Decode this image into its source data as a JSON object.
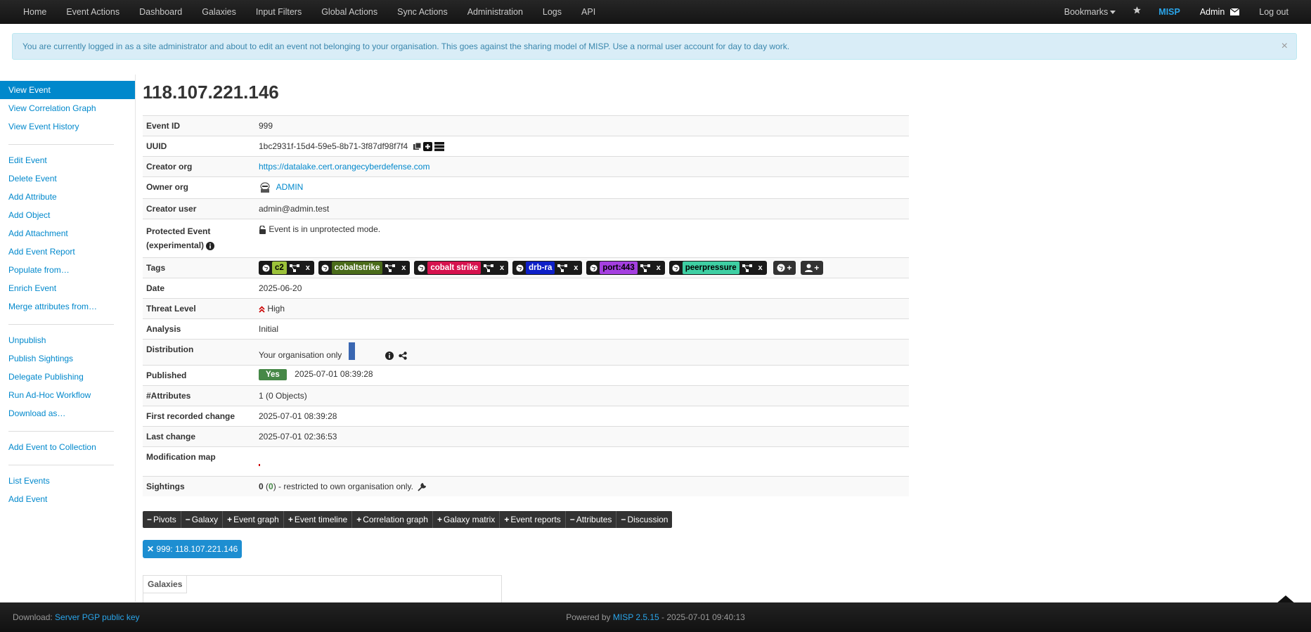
{
  "nav": {
    "left": [
      "Home",
      "Event Actions",
      "Dashboard",
      "Galaxies",
      "Input Filters",
      "Global Actions",
      "Sync Actions",
      "Administration",
      "Logs",
      "API"
    ],
    "bookmarks": "Bookmarks",
    "misp": "MISP",
    "admin": "Admin",
    "logout": "Log out"
  },
  "alert": {
    "text": "You are currently logged in as a site administrator and about to edit an event not belonging to your organisation. This goes against the sharing model of MISP. Use a normal user account for day to day work.",
    "close": "×"
  },
  "sidebar": {
    "group1": [
      "View Event",
      "View Correlation Graph",
      "View Event History"
    ],
    "group2": [
      "Edit Event",
      "Delete Event",
      "Add Attribute",
      "Add Object",
      "Add Attachment",
      "Add Event Report",
      "Populate from…",
      "Enrich Event",
      "Merge attributes from…"
    ],
    "group3": [
      "Unpublish",
      "Publish Sightings",
      "Delegate Publishing",
      "Run Ad-Hoc Workflow",
      "Download as…"
    ],
    "group4": [
      "Add Event to Collection"
    ],
    "group5": [
      "List Events",
      "Add Event"
    ]
  },
  "event": {
    "title": "118.107.221.146",
    "labels": {
      "id": "Event ID",
      "uuid": "UUID",
      "creator_org": "Creator org",
      "owner_org": "Owner org",
      "creator_user": "Creator user",
      "protected": "Protected Event (experimental)",
      "tags": "Tags",
      "date": "Date",
      "threat": "Threat Level",
      "analysis": "Analysis",
      "distribution": "Distribution",
      "published": "Published",
      "attributes": "#Attributes",
      "first_change": "First recorded change",
      "last_change": "Last change",
      "modmap": "Modification map",
      "sightings": "Sightings"
    },
    "id": "999",
    "uuid": "1bc2931f-15d4-59e5-8b71-3f87df98f7f4",
    "creator_org": "https://datalake.cert.orangecyberdefense.com",
    "owner_org": "ADMIN",
    "creator_user": "admin@admin.test",
    "protected": "Event is in unprotected mode.",
    "date": "2025-06-20",
    "threat": "High",
    "analysis": "Initial",
    "distribution": "Your organisation only",
    "published_badge": "Yes",
    "published_date": "2025-07-01 08:39:28",
    "attributes": "1 (0 Objects)",
    "first_change": "2025-07-01 08:39:28",
    "last_change": "2025-07-01 02:36:53",
    "sightings_count": "0",
    "sightings_paren_open": " (",
    "sightings_inner": "0",
    "sightings_rest": ") - restricted to own organisation only."
  },
  "tags": [
    {
      "name": "c2",
      "bg": "#9cc23a",
      "fg": "#000"
    },
    {
      "name": "cobaltstrike",
      "bg": "#4a6b1a",
      "fg": "#fff"
    },
    {
      "name": "cobalt strike",
      "bg": "#d6124e",
      "fg": "#fff"
    },
    {
      "name": "drb-ra",
      "bg": "#0d1fc7",
      "fg": "#fff"
    },
    {
      "name": "port:443",
      "bg": "#a53fe0",
      "fg": "#000"
    },
    {
      "name": "peerpressure",
      "bg": "#3ecfa3",
      "fg": "#000"
    }
  ],
  "tabs": [
    "Pivots",
    "Galaxy",
    "Event graph",
    "Event timeline",
    "Correlation graph",
    "Galaxy matrix",
    "Event reports",
    "Attributes",
    "Discussion"
  ],
  "tab_signs": [
    "−",
    "−",
    "+",
    "+",
    "+",
    "+",
    "+",
    "−",
    "−"
  ],
  "pivot_button": "999: 118.107.221.146",
  "galaxies_header": "Galaxies",
  "footer": {
    "download_label": "Download: ",
    "download_link": "Server PGP public key",
    "powered": "Powered by ",
    "version": "MISP 2.5.15",
    "timestamp": " - 2025-07-01 09:40:13"
  },
  "colors": {
    "accent": "#0088cc",
    "threat_high": "#c00",
    "published": "#468847"
  }
}
